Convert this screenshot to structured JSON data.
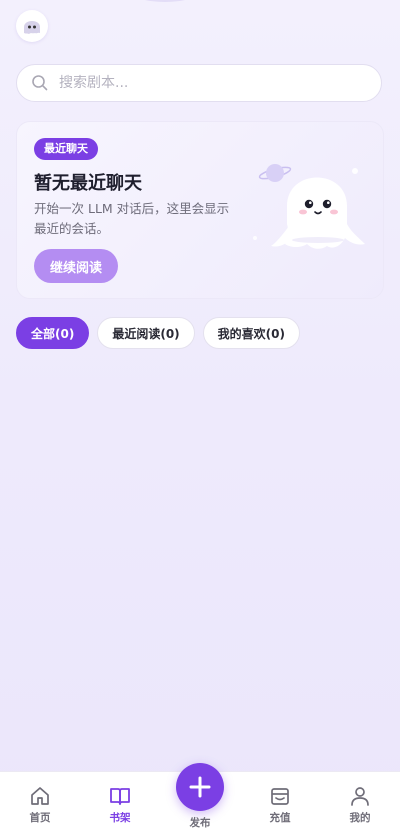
{
  "search": {
    "placeholder": "搜索剧本..."
  },
  "card": {
    "badge": "最近聊天",
    "title": "暂无最近聊天",
    "description": "开始一次 LLM 对话后，这里会显示最近的会话。",
    "button_label": "继续阅读"
  },
  "filters": [
    {
      "label": "全部(0)",
      "active": true
    },
    {
      "label": "最近阅读(0)",
      "active": false
    },
    {
      "label": "我的喜欢(0)",
      "active": false
    }
  ],
  "tabbar": {
    "home": "首页",
    "shelf": "书架",
    "publish": "发布",
    "recharge": "充值",
    "mine": "我的",
    "active": "shelf"
  },
  "colors": {
    "accent": "#7b3fe4",
    "accent_light": "#b48df2"
  }
}
